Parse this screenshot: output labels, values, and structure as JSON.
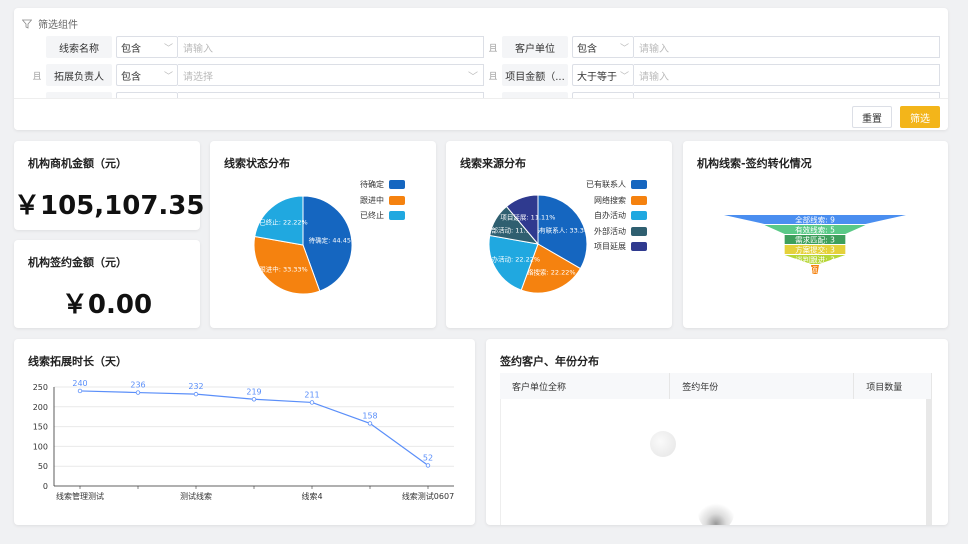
{
  "filter": {
    "title": "筛选组件",
    "conj": "且",
    "rows": [
      {
        "label": "线索名称",
        "op": "包含",
        "placeholder": "请输入"
      },
      {
        "label": "客户单位",
        "op": "包含",
        "placeholder": "请输入"
      },
      {
        "label": "拓展负责人",
        "op": "包含",
        "placeholder": "请选择"
      },
      {
        "label": "项目金额（...",
        "op": "大于等于",
        "placeholder": "请输入"
      }
    ],
    "reset_label": "重置",
    "filter_label": "筛选"
  },
  "kpi": {
    "opportunity_title": "机构商机金额（元）",
    "opportunity_value": "￥105,107.35",
    "signed_title": "机构签约金额（元）",
    "signed_value": "￥0.00"
  },
  "status_chart": {
    "title": "线索状态分布",
    "colors": [
      "#1566c0",
      "#f5820f",
      "#20a8e0"
    ],
    "chart_data": {
      "type": "pie",
      "labels": [
        "待确定",
        "跟进中",
        "已终止"
      ],
      "values": [
        44.45,
        33.33,
        22.22
      ],
      "data_labels": [
        "待确定: 44.45%",
        "跟进中: 33.33%",
        "已终止: 22.22%"
      ]
    }
  },
  "source_chart": {
    "title": "线索来源分布",
    "colors": [
      "#1566c0",
      "#f5820f",
      "#20a8e0",
      "#2f5f70",
      "#2f3a8f"
    ],
    "chart_data": {
      "type": "pie",
      "labels": [
        "已有联系人",
        "网络搜索",
        "自办活动",
        "外部活动",
        "项目延展"
      ],
      "values": [
        33.34,
        22.22,
        22.22,
        11.11,
        11.11
      ],
      "data_labels": [
        "已有联系人: 33.34%",
        "网络搜索: 22.22%",
        "自办活动: 22.22%",
        "外部活动: 11.11%",
        "项目延展: 11.11%"
      ]
    }
  },
  "funnel_chart": {
    "title": "机构线索-签约转化情况",
    "colors": [
      "#4a8ef0",
      "#5ac987",
      "#3e9f5c",
      "#e5d13a",
      "#b6d636",
      "#f5820f"
    ],
    "chart_data": {
      "type": "funnel",
      "labels": [
        "全部线索",
        "有效线索",
        "需求匹配",
        "方案提交",
        "谈判跟进",
        "签约项目"
      ],
      "values": [
        9,
        5,
        3,
        3,
        3,
        0
      ]
    }
  },
  "duration_chart": {
    "title": "线索拓展时长（天）",
    "color": "#5b8ff9",
    "chart_data": {
      "type": "line",
      "x": [
        "线索管理测试",
        "",
        "测试线索",
        "",
        "线索4",
        "",
        "线索测试0607"
      ],
      "y": [
        240,
        236,
        232,
        219,
        211,
        158,
        52
      ],
      "ylim": [
        0,
        250
      ],
      "yticks": [
        0,
        50,
        100,
        150,
        200,
        250
      ]
    }
  },
  "signed_table": {
    "title": "签约客户、年份分布",
    "columns": [
      "客户单位全称",
      "签约年份",
      "项目数量"
    ]
  }
}
